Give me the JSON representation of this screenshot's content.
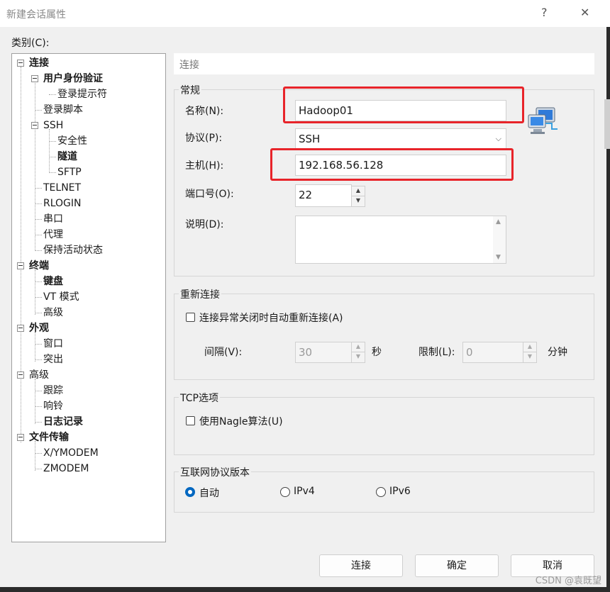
{
  "window": {
    "title": "新建会话属性",
    "help": "?",
    "close": "✕"
  },
  "category_label": "类别(C):",
  "tree": {
    "connection": "连接",
    "user_auth": "用户身份验证",
    "login_prompt": "登录提示符",
    "login_script": "登录脚本",
    "ssh": "SSH",
    "security": "安全性",
    "tunnel": "隧道",
    "sftp": "SFTP",
    "telnet": "TELNET",
    "rlogin": "RLOGIN",
    "serial": "串口",
    "proxy": "代理",
    "keepalive": "保持活动状态",
    "terminal": "终端",
    "keyboard": "键盘",
    "vt_mode": "VT 模式",
    "advanced": "高级",
    "appearance": "外观",
    "window": "窗口",
    "highlight": "突出",
    "advanced2": "高级",
    "trace": "跟踪",
    "bell": "响铃",
    "logging": "日志记录",
    "file_transfer": "文件传输",
    "xymodem": "X/YMODEM",
    "zmodem": "ZMODEM"
  },
  "panel": {
    "header": "连接",
    "general": {
      "label": "常规",
      "name_label": "名称(N):",
      "name_value": "Hadoop01",
      "protocol_label": "协议(P):",
      "protocol_value": "SSH",
      "host_label": "主机(H):",
      "host_value": "192.168.56.128",
      "port_label": "端口号(O):",
      "port_value": "22",
      "desc_label": "说明(D):"
    },
    "reconnect": {
      "label": "重新连接",
      "checkbox_label": "连接异常关闭时自动重新连接(A)",
      "interval_label": "间隔(V):",
      "interval_value": "30",
      "interval_unit": "秒",
      "limit_label": "限制(L):",
      "limit_value": "0",
      "limit_unit": "分钟"
    },
    "tcp": {
      "label": "TCP选项",
      "nagle_label": "使用Nagle算法(U)"
    },
    "ip_version": {
      "label": "互联网协议版本",
      "options": [
        "自动",
        "IPv4",
        "IPv6"
      ],
      "selected": "自动"
    }
  },
  "buttons": {
    "connect": "连接",
    "ok": "确定",
    "cancel": "取消"
  },
  "watermark": "CSDN @袁既望",
  "colors": {
    "accent": "#0067c0",
    "highlight_box": "#e8242a"
  }
}
